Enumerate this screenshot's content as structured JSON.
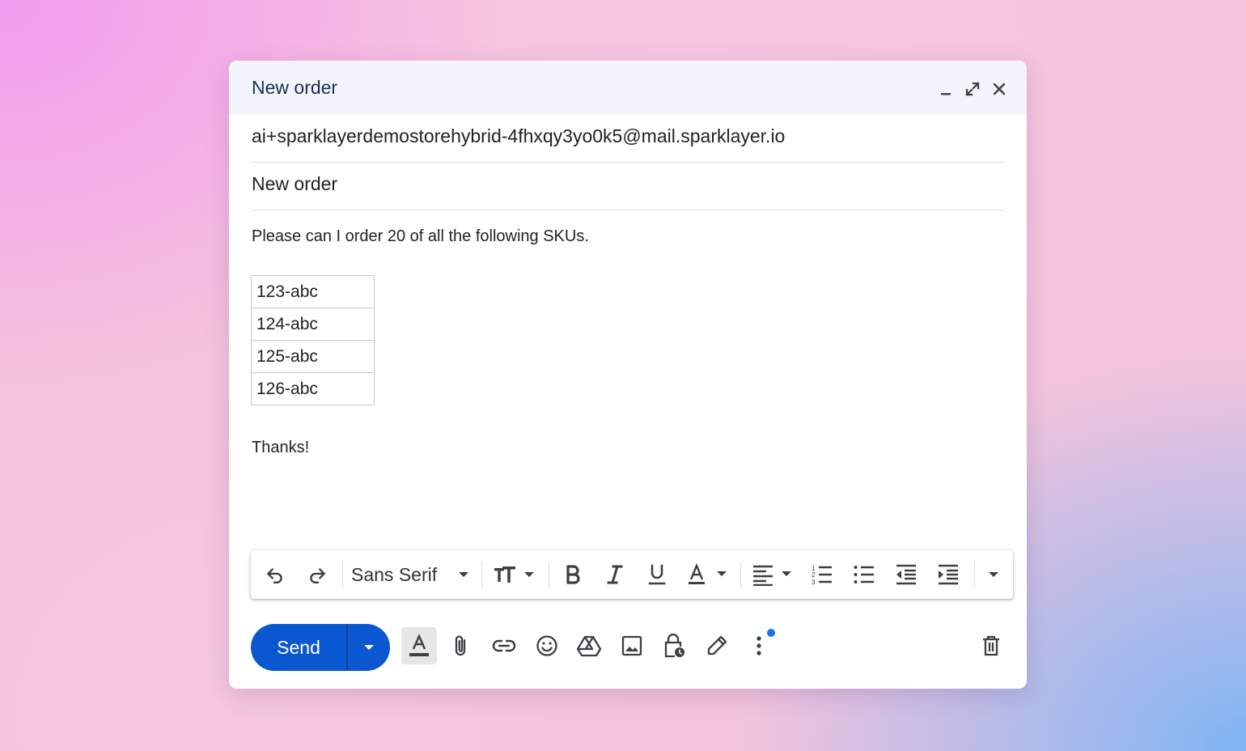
{
  "window": {
    "title": "New order",
    "controls": [
      "minimize-icon",
      "expand-icon",
      "close-icon"
    ]
  },
  "fields": {
    "to": "ai+sparklayerdemostorehybrid-4fhxqy3yo0k5@mail.sparklayer.io",
    "subject": "New order"
  },
  "body": {
    "intro": "Please can I order 20 of all the following SKUs.",
    "skus": [
      "123-abc",
      "124-abc",
      "125-abc",
      "126-abc"
    ],
    "closing": "Thanks!"
  },
  "format_toolbar": {
    "font": "Sans Serif",
    "icons": [
      "undo-icon",
      "redo-icon",
      "font-chevron-icon",
      "text-size-icon",
      "bold-icon",
      "italic-icon",
      "underline-icon",
      "text-color-icon",
      "align-icon",
      "numbered-list-icon",
      "bulleted-list-icon",
      "indent-less-icon",
      "indent-more-icon",
      "more-formatting-icon"
    ]
  },
  "bottom_bar": {
    "send_label": "Send",
    "icons": [
      "formatting-options-icon",
      "attach-icon",
      "link-icon",
      "emoji-icon",
      "drive-icon",
      "photo-icon",
      "confidential-icon",
      "signature-icon",
      "more-options-icon",
      "discard-icon"
    ]
  },
  "colors": {
    "send_button": "#0b57d0",
    "title_bar": "#f2f6fc",
    "notification_dot": "#1a73e8"
  }
}
